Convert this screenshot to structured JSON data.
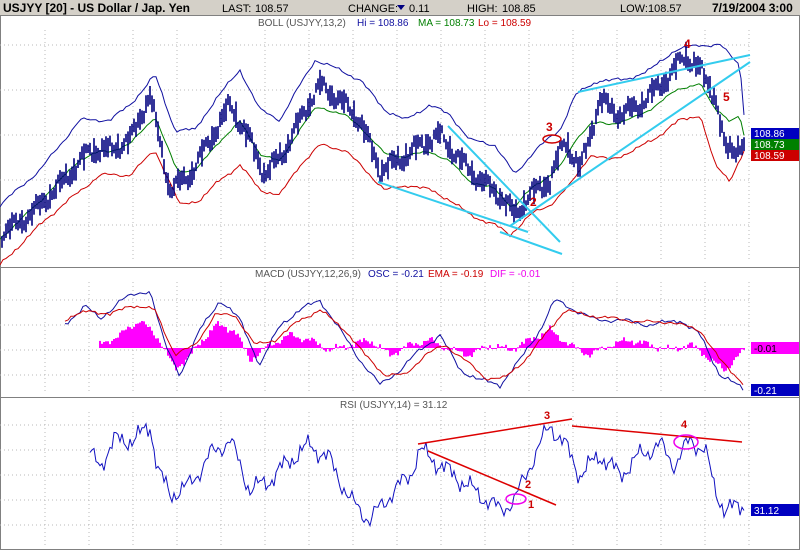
{
  "header": {
    "title": "USJYY [20] - US Dollar / Jap. Yen",
    "last_label": "LAST:",
    "last_value": "108.57",
    "change_label": "CHANGE:",
    "change_value": "0.11",
    "high_label": "HIGH:",
    "high_value": "108.85",
    "low_label": "LOW:",
    "low_value": "108.57",
    "datetime": "7/19/2004 3:00"
  },
  "colors": {
    "header_bg": "#d4d0c8",
    "price": "#00007f",
    "boll_upper": "#1010a0",
    "boll_mid": "#007f00",
    "boll_lower": "#cc0000",
    "trendline": "#33ccee",
    "macd_line": "#1010a0",
    "ema_line": "#cc0000",
    "histogram": "#ff00ff",
    "rsi_line": "#1010c0",
    "rsi_trend": "#dd0000",
    "annotation": "#cc0000",
    "oval": "#ee00ee",
    "grid": "#b8b8b8"
  },
  "panes": {
    "boll": {
      "title_prefix": "BOLL (USJYY,13,2)",
      "hi_text": "Hi = 108.86",
      "ma_text": "MA = 108.73",
      "lo_text": "Lo = 108.59",
      "tags": [
        "108.86",
        "108.73",
        "108.59"
      ]
    },
    "macd": {
      "title_prefix": "MACD (USJYY,12,26,9)",
      "osc_text": "OSC = -0.21",
      "ema_text": "EMA = -0.19",
      "dif_text": "DIF = -0.01",
      "tags": [
        "-0.01",
        "-0.21"
      ]
    },
    "rsi": {
      "title": "RSI (USJYY,14) = 31.12",
      "tag": "31.12"
    }
  },
  "annotations": {
    "boll": [
      "3",
      "2",
      "4",
      "5"
    ],
    "rsi": [
      "3",
      "4",
      "2",
      "1"
    ]
  },
  "chart_data": [
    {
      "type": "line",
      "title": "USJYY [20] - US Dollar / Jap. Yen",
      "subtitle": "BOLL (USJYY,13,2)",
      "series": [
        {
          "name": "Hi",
          "last": 108.86
        },
        {
          "name": "MA",
          "last": 108.73
        },
        {
          "name": "Lo",
          "last": 108.59
        }
      ],
      "price_last": 108.57,
      "price_high": 108.85,
      "price_low": 108.57,
      "change": 0.11
    },
    {
      "type": "line",
      "title": "MACD (USJYY,12,26,9)",
      "series": [
        {
          "name": "OSC",
          "last": -0.21
        },
        {
          "name": "EMA",
          "last": -0.19
        },
        {
          "name": "DIF",
          "last": -0.01
        }
      ]
    },
    {
      "type": "line",
      "title": "RSI (USJYY,14)",
      "series": [
        {
          "name": "RSI",
          "last": 31.12
        }
      ]
    }
  ]
}
